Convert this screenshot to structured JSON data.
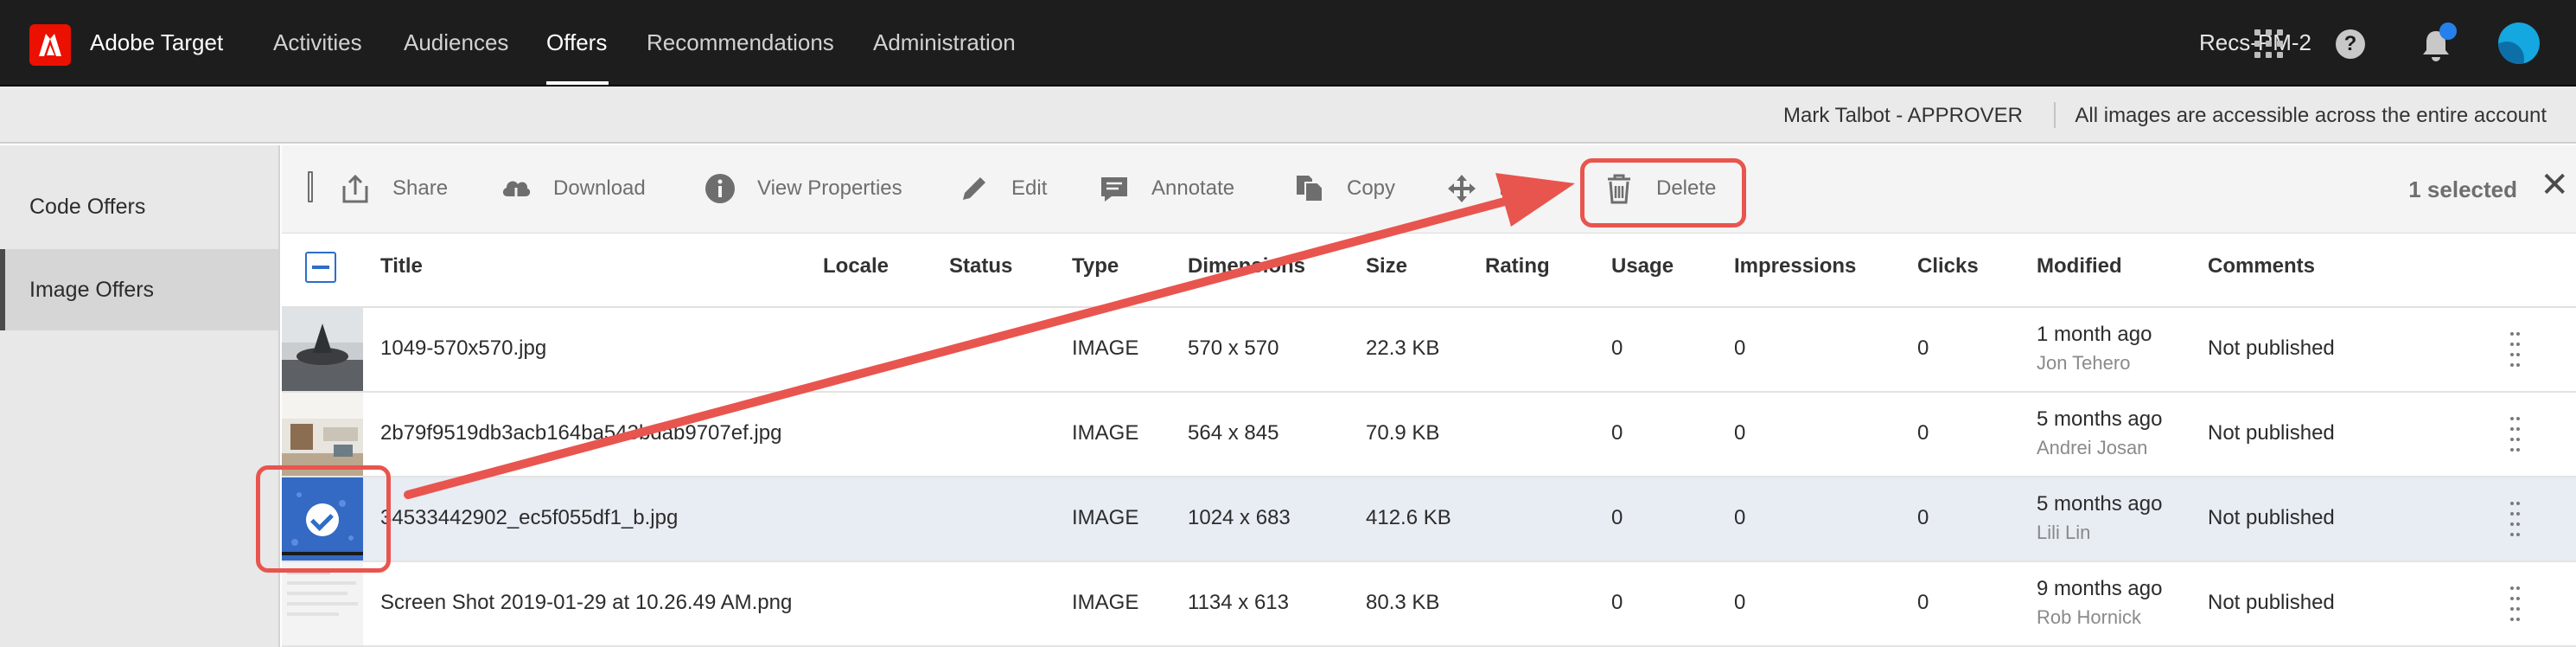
{
  "nav": {
    "app_name": "Adobe Target",
    "items": [
      {
        "label": "Activities"
      },
      {
        "label": "Audiences"
      },
      {
        "label": "Offers",
        "active": true
      },
      {
        "label": "Recommendations"
      },
      {
        "label": "Administration"
      }
    ],
    "workspace": "Recs-PM-2",
    "icons": [
      "adobe-logo-icon",
      "apps-grid-icon",
      "help-icon",
      "notifications-icon",
      "avatar"
    ],
    "accent_color": "#eb1000"
  },
  "infobar": {
    "user": "Mark Talbot - APPROVER",
    "message": "All images are accessible across the entire account"
  },
  "sidebar": {
    "items": [
      {
        "label": "Code Offers"
      },
      {
        "label": "Image Offers",
        "active": true
      }
    ]
  },
  "actions": {
    "items": [
      {
        "label": "Share",
        "icon": "share-icon"
      },
      {
        "label": "Download",
        "icon": "download-icon"
      },
      {
        "label": "View Properties",
        "icon": "info-icon"
      },
      {
        "label": "Edit",
        "icon": "pencil-icon"
      },
      {
        "label": "Annotate",
        "icon": "annotate-icon"
      },
      {
        "label": "Copy",
        "icon": "copy-icon"
      },
      {
        "label": "Move",
        "icon": "move-icon"
      },
      {
        "label": "Delete",
        "icon": "trash-icon"
      }
    ],
    "selected_count": "1 selected"
  },
  "table": {
    "columns": [
      "Title",
      "Locale",
      "Status",
      "Type",
      "Dimensions",
      "Size",
      "Rating",
      "Usage",
      "Impressions",
      "Clicks",
      "Modified",
      "Comments"
    ],
    "rows": [
      {
        "title": "1049-570x570.jpg",
        "type": "IMAGE",
        "dimensions": "570 x 570",
        "size": "22.3 KB",
        "usage": "0",
        "impressions": "0",
        "clicks": "0",
        "modified": "1 month ago",
        "modified_by": "Jon Tehero",
        "comments": "Not published",
        "selected": false
      },
      {
        "title": "2b79f9519db3acb164ba543bdab9707ef.jpg",
        "type": "IMAGE",
        "dimensions": "564 x 845",
        "size": "70.9 KB",
        "usage": "0",
        "impressions": "0",
        "clicks": "0",
        "modified": "5 months ago",
        "modified_by": "Andrei Josan",
        "comments": "Not published",
        "selected": false
      },
      {
        "title": "34533442902_ec5f055df1_b.jpg",
        "type": "IMAGE",
        "dimensions": "1024 x 683",
        "size": "412.6 KB",
        "usage": "0",
        "impressions": "0",
        "clicks": "0",
        "modified": "5 months ago",
        "modified_by": "Lili Lin",
        "comments": "Not published",
        "selected": true
      },
      {
        "title": "Screen Shot 2019-01-29 at 10.26.49 AM.png",
        "type": "IMAGE",
        "dimensions": "1134 x 613",
        "size": "80.3 KB",
        "usage": "0",
        "impressions": "0",
        "clicks": "0",
        "modified": "9 months ago",
        "modified_by": "Rob Hornick",
        "comments": "Not published",
        "selected": false
      }
    ]
  },
  "annotation": {
    "highlight_color": "#e8554e"
  }
}
